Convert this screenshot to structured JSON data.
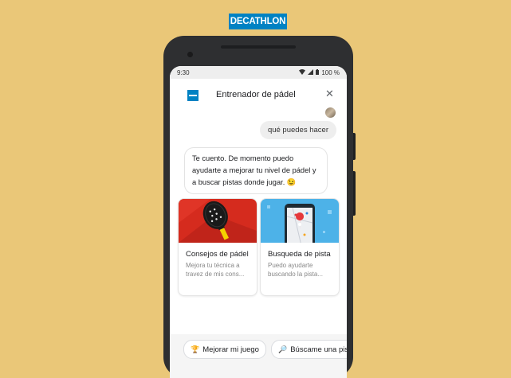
{
  "brand": {
    "logo_text": "DECATHLON",
    "color": "#0082C3"
  },
  "background_color": "#EAC778",
  "status_bar": {
    "time": "9:30",
    "battery": "100 %",
    "icons": [
      "wifi-icon",
      "signal-icon",
      "battery-icon"
    ]
  },
  "header": {
    "title": "Entrenador de pádel",
    "close_label": "✕"
  },
  "conversation": {
    "user_message": "qué puedes hacer",
    "bot_message": "Te cuento. De momento puedo ayudarte a mejorar tu nivel de pádel y a buscar pistas donde jugar. 😉"
  },
  "cards": [
    {
      "title": "Consejos de pádel",
      "description": "Mejora tu técnica a travez de mis cons...",
      "image": "padel-racket-image"
    },
    {
      "title": "Busqueda de pista",
      "description": "Puedo ayudarte buscando la pista...",
      "image": "map-phone-image"
    }
  ],
  "chips": [
    {
      "icon": "🏆",
      "label": "Mejorar mi juego"
    },
    {
      "icon": "🔎",
      "label": "Búscame una pis"
    }
  ]
}
